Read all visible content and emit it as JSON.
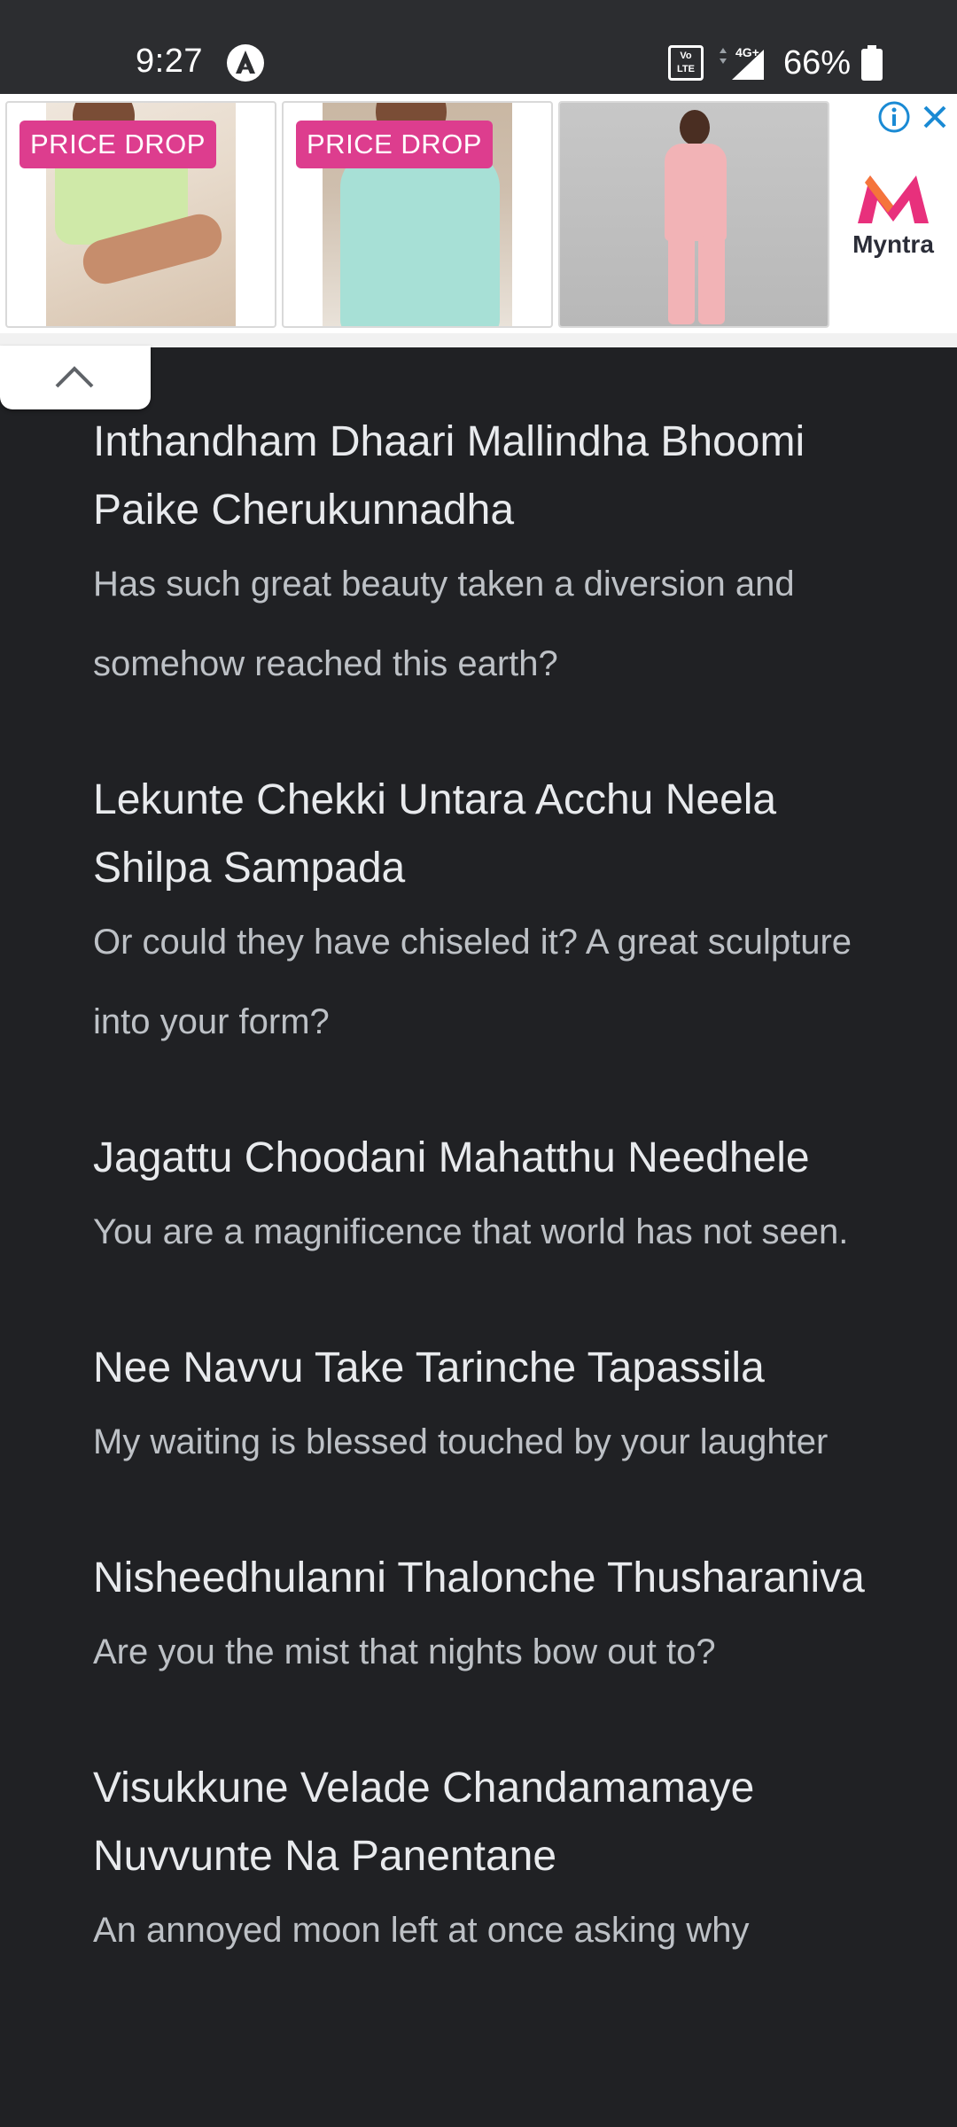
{
  "status_bar": {
    "time": "9:27",
    "battery": "66%",
    "network": "4G+",
    "volte": "Vo LTE"
  },
  "ad": {
    "cards": [
      {
        "tag": "PRICE DROP"
      },
      {
        "tag": "PRICE DROP"
      },
      {
        "tag": ""
      }
    ],
    "brand": "Myntra",
    "brand_color": "#e8307c",
    "info_icon": "info-icon",
    "close_icon": "close-icon"
  },
  "collapse": {
    "icon": "chevron-up-icon"
  },
  "lyrics": [
    {
      "line": "Inthandham Dhaari Mallindha Bhoomi Paike Cherukunnadha",
      "translation": "Has such great beauty taken a diversion and somehow reached this earth?"
    },
    {
      "line": "Lekunte Chekki Untara Acchu Neela Shilpa Sampada",
      "translation": "Or could they have chiseled it? A great sculpture into your form?"
    },
    {
      "line": "Jagattu Choodani Mahatthu Needhele",
      "translation": "You are a magnificence that world has not seen."
    },
    {
      "line": "Nee Navvu Take Tarinche Tapassila",
      "translation": "My waiting is blessed touched by your laughter"
    },
    {
      "line": "Nisheedhulanni Thalonche Thusharaniva",
      "translation": "Are you the mist that nights bow out to?"
    },
    {
      "line": "Visukkune Velade Chandamamaye Nuvvunte Na Panentane",
      "translation": "An annoyed moon left at once asking why"
    }
  ]
}
